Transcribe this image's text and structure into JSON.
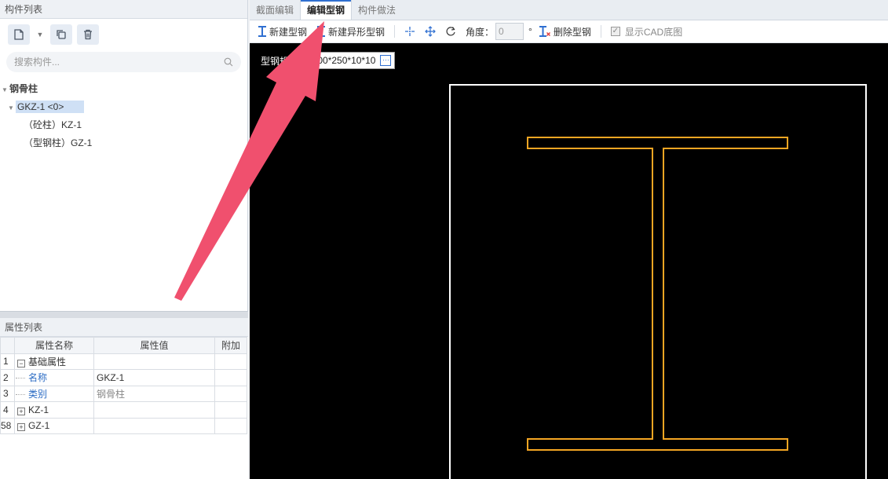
{
  "left": {
    "components_title": "构件列表",
    "search_placeholder": "搜索构件...",
    "tree": {
      "root": "钢骨柱",
      "selected": "GKZ-1 <0>",
      "children": [
        "（砼柱）KZ-1",
        "（型钢柱）GZ-1"
      ]
    },
    "props_title": "属性列表",
    "props_headers": [
      "属性名称",
      "属性值",
      "附加"
    ],
    "props_rows": [
      {
        "num": "1",
        "name": "基础属性",
        "value": ""
      },
      {
        "num": "2",
        "name": "名称",
        "value": "GKZ-1"
      },
      {
        "num": "3",
        "name": "类别",
        "value": "钢骨柱"
      },
      {
        "num": "4",
        "name": "KZ-1",
        "value": ""
      },
      {
        "num": "58",
        "name": "GZ-1",
        "value": ""
      }
    ]
  },
  "tabs": [
    "截面编辑",
    "编辑型钢",
    "构件做法"
  ],
  "toolbar": {
    "new_steel": "新建型钢",
    "new_special_steel": "新建异形型钢",
    "angle_label": "角度：",
    "angle_value": "0",
    "degree": "°",
    "delete_steel": "删除型钢",
    "show_cad": "显示CAD底图"
  },
  "canvas": {
    "spec_label": "型钢规格",
    "spec_value": "H300*250*10*10",
    "beam_color": "#f5a623",
    "frame_color": "#ffffff",
    "arrow_color": "#f0506e"
  }
}
